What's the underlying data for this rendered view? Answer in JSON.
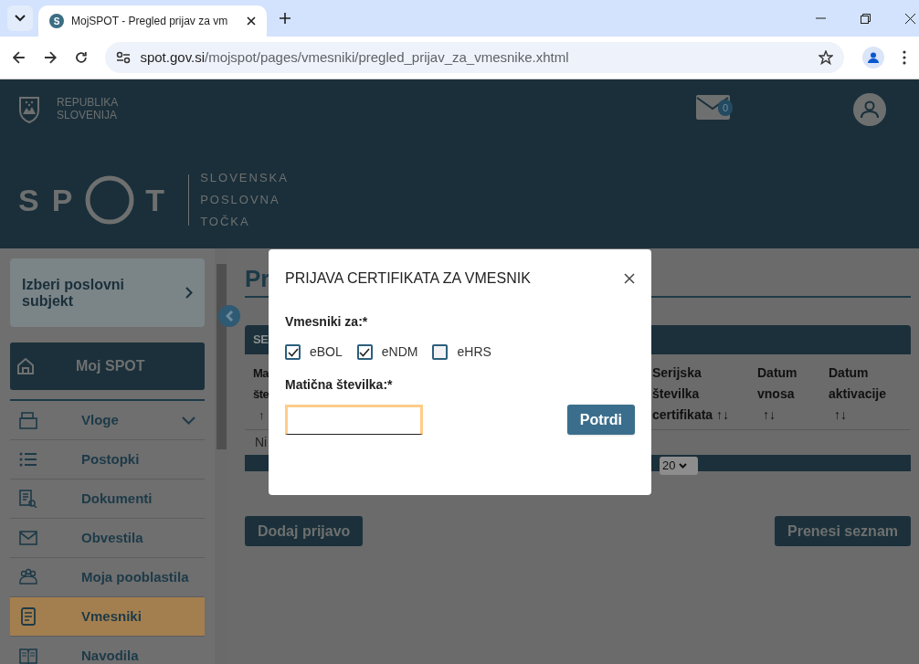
{
  "browser": {
    "tab_title": "MojSPOT - Pregled prijav za vm",
    "tab_favicon": "S",
    "url_host": "spot.gov.si",
    "url_path": "/mojspot/pages/vmesniki/pregled_prijav_za_vmesnike.xhtml"
  },
  "header": {
    "coat_lines": [
      "REPUBLIKA",
      "SLOVENIJA"
    ],
    "logo_left": "SP",
    "logo_right": "T",
    "tagline": [
      "SLOVENSKA",
      "POSLOVNA",
      "TOČKA"
    ],
    "mail_count": "0"
  },
  "sidebar": {
    "business_selector": "Izberi poslovni subjekt",
    "home": "Moj SPOT",
    "items": [
      {
        "label": "Vloge",
        "selected": false,
        "expandable": true
      },
      {
        "label": "Postopki",
        "selected": false,
        "expandable": false
      },
      {
        "label": "Dokumenti",
        "selected": false,
        "expandable": false
      },
      {
        "label": "Obvestila",
        "selected": false,
        "expandable": false
      },
      {
        "label": "Moja pooblastila",
        "selected": false,
        "expandable": false
      },
      {
        "label": "Vmesniki",
        "selected": true,
        "expandable": false
      },
      {
        "label": "Navodila",
        "selected": false,
        "expandable": false
      }
    ]
  },
  "main": {
    "title": "Pr",
    "panel_title": "SE",
    "first_column": [
      "Ma",
      "šte",
      "↑"
    ],
    "columns": [
      {
        "lines": [
          "Serijska",
          "številka",
          "certifikata"
        ],
        "sort": "↑↓"
      },
      {
        "lines": [
          "Datum",
          "vnosa"
        ],
        "sort": "↑↓"
      },
      {
        "lines": [
          "Datum",
          "aktivacije"
        ],
        "sort": "↑↓"
      }
    ],
    "empty_row": "Ni",
    "page_size": "20",
    "buttons": [
      "Dodaj prijavo",
      "Prenesi seznam"
    ]
  },
  "modal": {
    "title": "PRIJAVA CERTIFIKATA ZA VMESNIK",
    "group_label": "Vmesniki za:*",
    "options": [
      {
        "label": "eBOL",
        "checked": true
      },
      {
        "label": "eNDM",
        "checked": true
      },
      {
        "label": "eHRS",
        "checked": false
      }
    ],
    "field_label": "Matična številka:*",
    "field_focused": true,
    "submit": "Potrdi"
  }
}
